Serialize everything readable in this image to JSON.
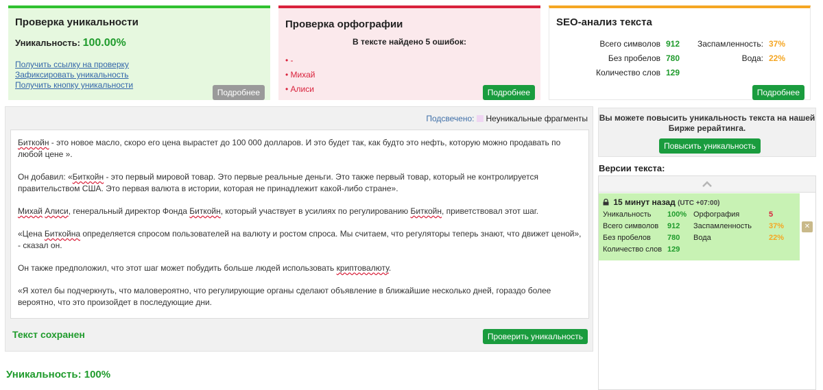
{
  "uniqueness_card": {
    "title": "Проверка уникальности",
    "label": "Уникальность:",
    "value": "100.00%",
    "links": [
      "Получить ссылку на проверку",
      "Зафиксировать уникальность",
      "Получить кнопку уникальности"
    ],
    "more_button": "Подробнее"
  },
  "spelling_card": {
    "title": "Проверка орфографии",
    "found_text": "В тексте найдено 5 ошибок:",
    "errors": [
      "-",
      "Михай",
      "Алиси"
    ],
    "more_button": "Подробнее"
  },
  "seo_card": {
    "title": "SEO-анализ текста",
    "total_chars_label": "Всего символов",
    "total_chars": "912",
    "no_spaces_label": "Без пробелов",
    "no_spaces": "780",
    "words_label": "Количество слов",
    "words": "129",
    "spam_label": "Заспамленность:",
    "spam": "37%",
    "water_label": "Вода:",
    "water": "22%",
    "more_button": "Подробнее"
  },
  "main": {
    "highlight_label": "Подсвечено:",
    "highlight_legend": "Неуникальные фрагменты",
    "paragraphs": {
      "p1a": "Биткойн",
      "p1b": " - это новое масло, скоро его цена вырастет до 100 000 долларов. И это будет так, как будто это нефть, которую можно продавать по любой цене ».",
      "p2a": "Он добавил: «",
      "p2b": "Биткойн",
      "p2c": " - это первый мировой товар. Это первые реальные деньги. Это также первый товар, который не контролируется правительством США. Это первая валюта в истории, которая не принадлежит какой-либо стране».",
      "p3a": "Михай",
      "p3b": " ",
      "p3c": "Алиси",
      "p3d": ", генеральный директор Фонда ",
      "p3e": "Биткойн",
      "p3f": ", который участвует в усилиях по регулированию ",
      "p3g": "Биткойн",
      "p3h": ", приветствовал этот шаг.",
      "p4a": "«Цена ",
      "p4b": "Биткойна",
      "p4c": " определяется спросом пользователей на валюту и ростом спроса. Мы считаем, что регуляторы теперь знают, что движет ценой», - сказал он.",
      "p5a": "Он также предположил, что этот шаг может побудить больше людей использовать ",
      "p5b": "криптовалюту",
      "p5c": ".",
      "p6": "«Я хотел бы подчеркнуть, что маловероятно, что регулирующие органы сделают объявление в ближайшие несколько дней, гораздо более вероятно, что это произойдет в последующие дни."
    },
    "saved_text": "Текст сохранен",
    "check_button": "Проверить уникальность",
    "bottom_uniqueness": "Уникальность: 100%"
  },
  "sidebar": {
    "promo_text": "Вы можете повысить уникальность текста на нашей Бирже рерайтинга.",
    "promo_button": "Повысить уникальность",
    "versions_title": "Версии текста:",
    "version": {
      "time": "15 минут назад",
      "timezone": "(UTC +07:00)",
      "uniqueness_label": "Уникальность",
      "uniqueness": "100%",
      "spelling_label": "Орфография",
      "spelling": "5",
      "total_chars_label": "Всего символов",
      "total_chars": "912",
      "spam_label": "Заспамленность",
      "spam": "37%",
      "no_spaces_label": "Без пробелов",
      "no_spaces": "780",
      "water_label": "Вода",
      "water": "22%",
      "words_label": "Количество слов",
      "words": "129"
    }
  },
  "colors": {
    "green": "#1f9b2c",
    "red": "#d9223c",
    "orange": "#f5a623",
    "link": "#3366aa"
  }
}
